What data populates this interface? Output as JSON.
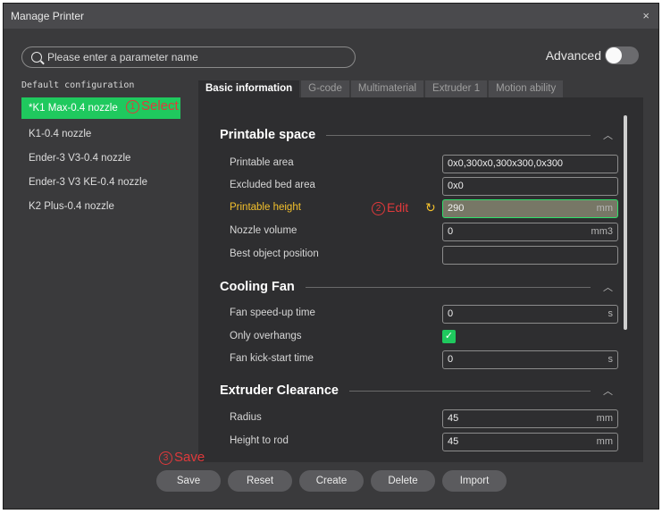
{
  "window": {
    "title": "Manage Printer",
    "close_glyph": "×"
  },
  "search": {
    "placeholder": "Please enter a parameter name"
  },
  "advanced": {
    "label": "Advanced",
    "enabled": false
  },
  "sidebar": {
    "heading": "Default configuration",
    "items": [
      {
        "label": "*K1 Max-0.4 nozzle",
        "selected": true
      },
      {
        "label": "K1-0.4 nozzle"
      },
      {
        "label": "Ender-3 V3-0.4 nozzle"
      },
      {
        "label": "Ender-3 V3 KE-0.4 nozzle"
      },
      {
        "label": "K2 Plus-0.4 nozzle"
      }
    ]
  },
  "annotations": {
    "select_num": "1",
    "select_text": "Select",
    "edit_num": "2",
    "edit_text": "Edit",
    "save_num": "3",
    "save_text": "Save"
  },
  "tabs": [
    {
      "label": "Basic information",
      "active": true
    },
    {
      "label": "G-code"
    },
    {
      "label": "Multimaterial"
    },
    {
      "label": "Extruder 1"
    },
    {
      "label": "Motion ability"
    }
  ],
  "sections": {
    "printable_space": {
      "title": "Printable space",
      "printable_area": {
        "label": "Printable area",
        "value": "0x0,300x0,300x300,0x300"
      },
      "excluded_bed_area": {
        "label": "Excluded bed area",
        "value": "0x0"
      },
      "printable_height": {
        "label": "Printable height",
        "value": "290",
        "unit": "mm"
      },
      "nozzle_volume": {
        "label": "Nozzle volume",
        "value": "0",
        "unit": "mm3"
      },
      "best_object_position": {
        "label": "Best object position",
        "value": ""
      }
    },
    "cooling_fan": {
      "title": "Cooling Fan",
      "fan_speed_up_time": {
        "label": "Fan speed-up time",
        "value": "0",
        "unit": "s"
      },
      "only_overhangs": {
        "label": "Only overhangs",
        "checked": true
      },
      "fan_kick_start_time": {
        "label": "Fan kick-start time",
        "value": "0",
        "unit": "s"
      }
    },
    "extruder_clearance": {
      "title": "Extruder Clearance",
      "radius": {
        "label": "Radius",
        "value": "45",
        "unit": "mm"
      },
      "height_to_rod": {
        "label": "Height to rod",
        "value": "45",
        "unit": "mm"
      }
    }
  },
  "buttons": {
    "save": "Save",
    "reset": "Reset",
    "create": "Create",
    "delete": "Delete",
    "import": "Import"
  },
  "colors": {
    "accent_green": "#1fc95e",
    "highlight_yellow": "#f3c02c",
    "annotation_red": "#e0393b"
  }
}
